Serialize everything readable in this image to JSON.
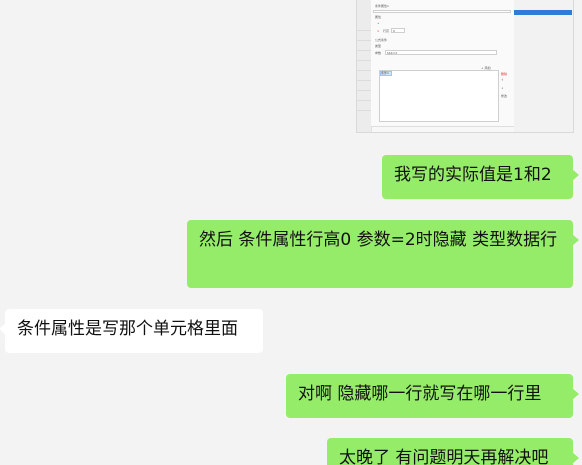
{
  "thumbnail": {
    "title_text": "条件属性1",
    "section_label": "属性",
    "row_height_label": "行高",
    "value_text": "0",
    "condition_label": "公式条件",
    "type_label": "类型",
    "param_label": "参数",
    "formula_text": "$$$=2",
    "add_button": "+ 添加",
    "edit_button": "修改",
    "delete_button": "删除",
    "selected_item": "条件1"
  },
  "messages": [
    {
      "text": "我写的实际值是1和2"
    },
    {
      "text": "然后 条件属性行高0  参数=2时隐藏 类型数据行"
    },
    {
      "text": "条件属性是写那个单元格里面"
    },
    {
      "text": "对啊  隐藏哪一行就写在哪一行里"
    },
    {
      "text": "太晚了 有问题明天再解决吧"
    }
  ]
}
